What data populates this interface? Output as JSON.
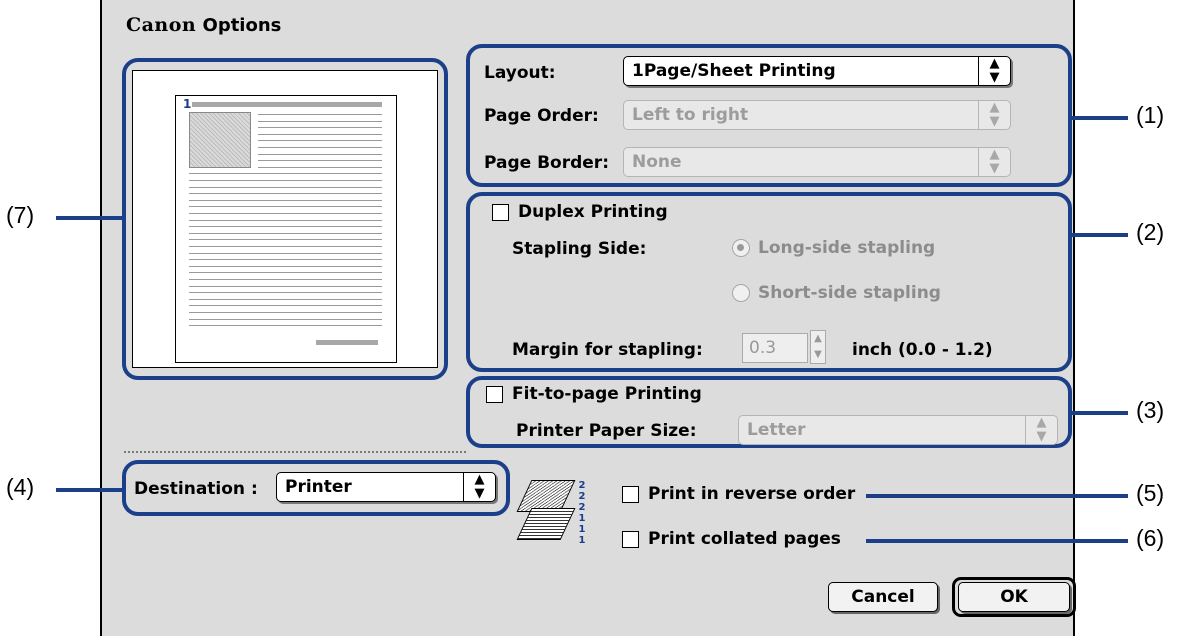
{
  "window": {
    "brand": "Canon",
    "title": "Options"
  },
  "layout_group": {
    "layout_label": "Layout:",
    "layout_value": "1Page/Sheet Printing",
    "page_order_label": "Page Order:",
    "page_order_value": "Left to right",
    "page_border_label": "Page Border:",
    "page_border_value": "None"
  },
  "duplex_group": {
    "duplex_label": "Duplex Printing",
    "stapling_side_label": "Stapling Side:",
    "long_side_label": "Long-side stapling",
    "short_side_label": "Short-side stapling",
    "margin_label": "Margin for stapling:",
    "margin_value": "0.3",
    "margin_unit": "inch (0.0 - 1.2)"
  },
  "fit_group": {
    "fit_label": "Fit-to-page Printing",
    "paper_size_label": "Printer Paper Size:",
    "paper_size_value": "Letter"
  },
  "destination": {
    "label": "Destination :",
    "value": "Printer"
  },
  "options": {
    "reverse_order_label": "Print in reverse order",
    "collated_label": "Print collated pages",
    "stack_numbers": [
      "2",
      "2",
      "2",
      "1",
      "1",
      "1"
    ]
  },
  "preview": {
    "page_number": "1"
  },
  "buttons": {
    "cancel": "Cancel",
    "ok": "OK"
  },
  "callouts": {
    "c1": "(1)",
    "c2": "(2)",
    "c3": "(3)",
    "c4": "(4)",
    "c5": "(5)",
    "c6": "(6)",
    "c7": "(7)"
  },
  "colors": {
    "highlight": "#1c3f8a",
    "dialog_bg": "#dcdcdc"
  }
}
